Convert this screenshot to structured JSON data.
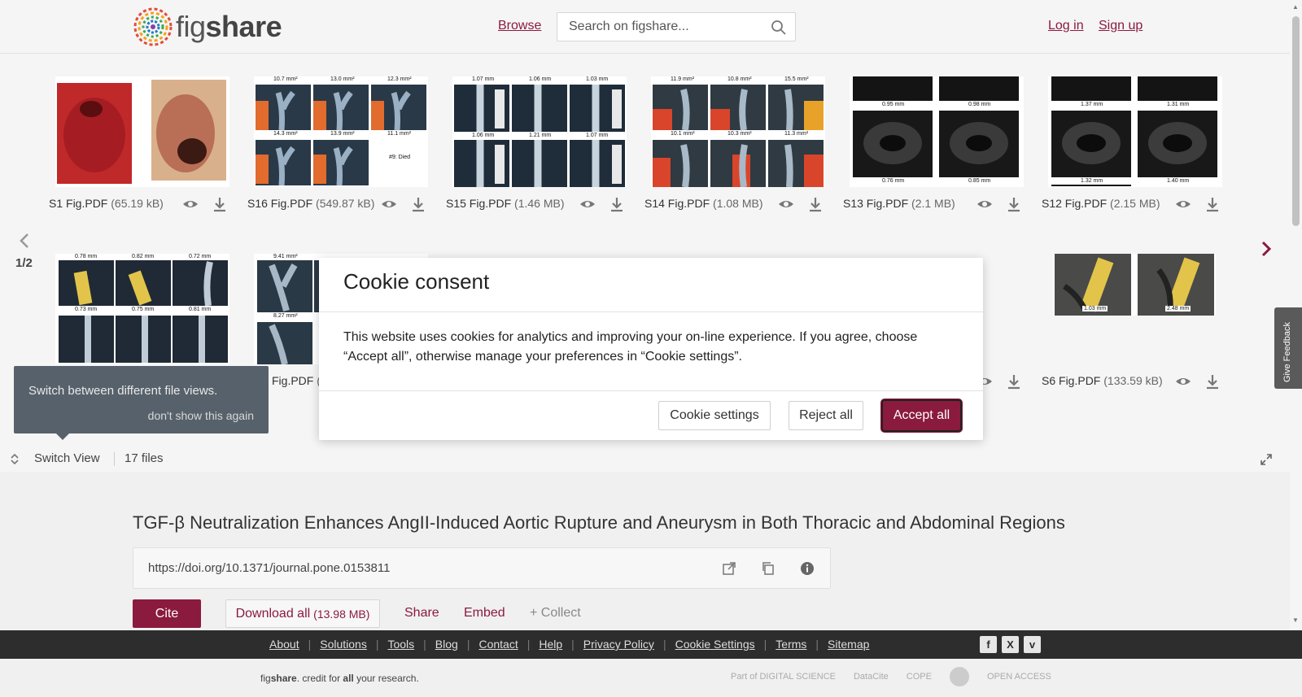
{
  "header": {
    "logo_prefix": "fig",
    "logo_suffix": "share",
    "browse": "Browse",
    "search_placeholder": "Search on figshare...",
    "login": "Log in",
    "signup": "Sign up"
  },
  "gallery": {
    "pager": "1/2",
    "row1": [
      {
        "name": "S1 Fig.PDF",
        "size": "(65.19 kB)"
      },
      {
        "name": "S16 Fig.PDF",
        "size": "(549.87 kB)"
      },
      {
        "name": "S15 Fig.PDF",
        "size": "(1.46 MB)"
      },
      {
        "name": "S14 Fig.PDF",
        "size": "(1.08 MB)"
      },
      {
        "name": "S13 Fig.PDF",
        "size": "(2.1 MB)"
      },
      {
        "name": "S12 Fig.PDF",
        "size": "(2.15 MB)"
      }
    ],
    "row2": [
      {
        "name": "",
        "size": ""
      },
      {
        "name": "Fig.PDF",
        "size": "("
      },
      {
        "name": "",
        "size": ""
      },
      {
        "name": "",
        "size": ""
      },
      {
        "name": "",
        "size": ""
      },
      {
        "name": "S6 Fig.PDF",
        "size": "(133.59 kB)"
      }
    ],
    "thumb_labels": {
      "t1": [
        "10.7 mm²",
        "13.0 mm²",
        "12.3 mm²",
        "14.3 mm²",
        "13.9 mm²",
        "11.1 mm²",
        "#9: Died"
      ],
      "t2": [
        "1.07 mm",
        "1.06 mm",
        "1.03 mm",
        "1.06 mm",
        "1.21 mm",
        "1.07 mm"
      ],
      "t3": [
        "11.9 mm²",
        "10.8 mm²",
        "15.5 mm²",
        "10.1 mm²",
        "10.3 mm²",
        "11.3 mm²"
      ],
      "t4": [
        "0.95 mm",
        "0.98 mm",
        "0.76 mm",
        "0.85 mm"
      ],
      "t5": [
        "1.37 mm",
        "1.31 mm",
        "1.32 mm",
        "1.40 mm"
      ],
      "t6": [
        "0.78 mm",
        "0.82 mm",
        "0.72 mm",
        "0.73 mm",
        "0.75 mm",
        "0.81 mm"
      ],
      "t7": [
        "9.41 mm²",
        "8.27 mm²"
      ],
      "t8": [
        "1.03 mm",
        "2.48 mm"
      ]
    },
    "tooltip_text": "Switch between different file views.",
    "tooltip_dismiss": "don't show this again",
    "switch_view": "Switch View",
    "files_count": "17 files"
  },
  "article": {
    "title": "TGF-β Neutralization Enhances AngII-Induced Aortic Rupture and Aneurysm in Both Thoracic and Abdominal Regions",
    "doi": "https://doi.org/10.1371/journal.pone.0153811",
    "cite": "Cite",
    "download_all": "Download all",
    "download_size": "(13.98 MB)",
    "share": "Share",
    "embed": "Embed",
    "collect": "+ Collect"
  },
  "cookie": {
    "title": "Cookie consent",
    "body": "This website uses cookies for analytics and improving your on-line experience. If you agree, choose “Accept all”, otherwise manage your preferences in “Cookie settings”.",
    "settings": "Cookie settings",
    "reject": "Reject all",
    "accept": "Accept all"
  },
  "feedback": "Give Feedback",
  "footer": {
    "links": [
      "About",
      "Solutions",
      "Tools",
      "Blog",
      "Contact",
      "Help",
      "Privacy Policy",
      "Cookie Settings",
      "Terms",
      "Sitemap"
    ],
    "credit_pre": "fig",
    "credit_brand": "share",
    "credit_mid": ". credit for ",
    "credit_bold": "all",
    "credit_post": " your research.",
    "partners": [
      "Part of DIGITAL SCIENCE",
      "DataCite",
      "COPE",
      "",
      "OPEN ACCESS"
    ],
    "social": [
      "facebook-icon",
      "x-icon",
      "vimeo-icon"
    ]
  },
  "colors": {
    "accent": "#8b1a3f",
    "footer_dark": "#2d2d2d"
  }
}
